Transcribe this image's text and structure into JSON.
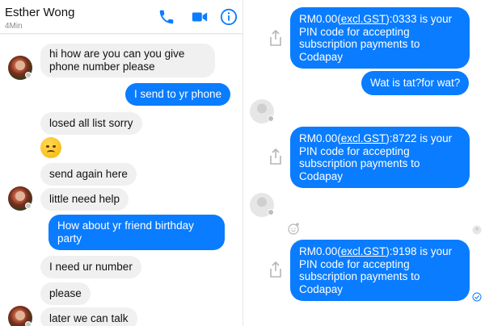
{
  "header": {
    "contact_name": "Esther Wong",
    "status": "4Min",
    "icons": [
      "phone-icon",
      "video-camera-icon",
      "info-icon"
    ]
  },
  "left_messages": [
    {
      "side": "in",
      "text": "hi how are you can you give phone number please"
    },
    {
      "side": "out",
      "text": "I send to yr phone"
    },
    {
      "side": "in",
      "text": "losed all list sorry"
    },
    {
      "side": "in",
      "emoji": "sad-face-emoji"
    },
    {
      "side": "in",
      "text": "send again here"
    },
    {
      "side": "in",
      "text": "little need help"
    },
    {
      "side": "out",
      "text": "How about yr friend birthday party"
    },
    {
      "side": "in",
      "text": "I need ur number"
    },
    {
      "side": "in",
      "text": "please"
    },
    {
      "side": "in",
      "text": "later we can talk"
    }
  ],
  "right_messages": [
    {
      "prefix": "RM0.00(",
      "link": "excl.GST",
      "code": "):0333",
      "rest": " is your PIN code for accepting subscription payments to Codapay"
    },
    {
      "text": "Wat is tat?for wat?"
    },
    {
      "prefix": "RM0.00(",
      "link": "excl.GST",
      "code": "):8722",
      "rest": " is your PIN code for accepting subscription payments to Codapay"
    },
    {
      "prefix": "RM0.00(",
      "link": "excl.GST",
      "code": "):9198",
      "rest": " is your PIN code for accepting subscription payments to Codapay"
    }
  ],
  "colors": {
    "outgoing_bubble": "#0a7cff",
    "incoming_bubble": "#f1f0f0",
    "header_icons": "#0a7cff"
  }
}
